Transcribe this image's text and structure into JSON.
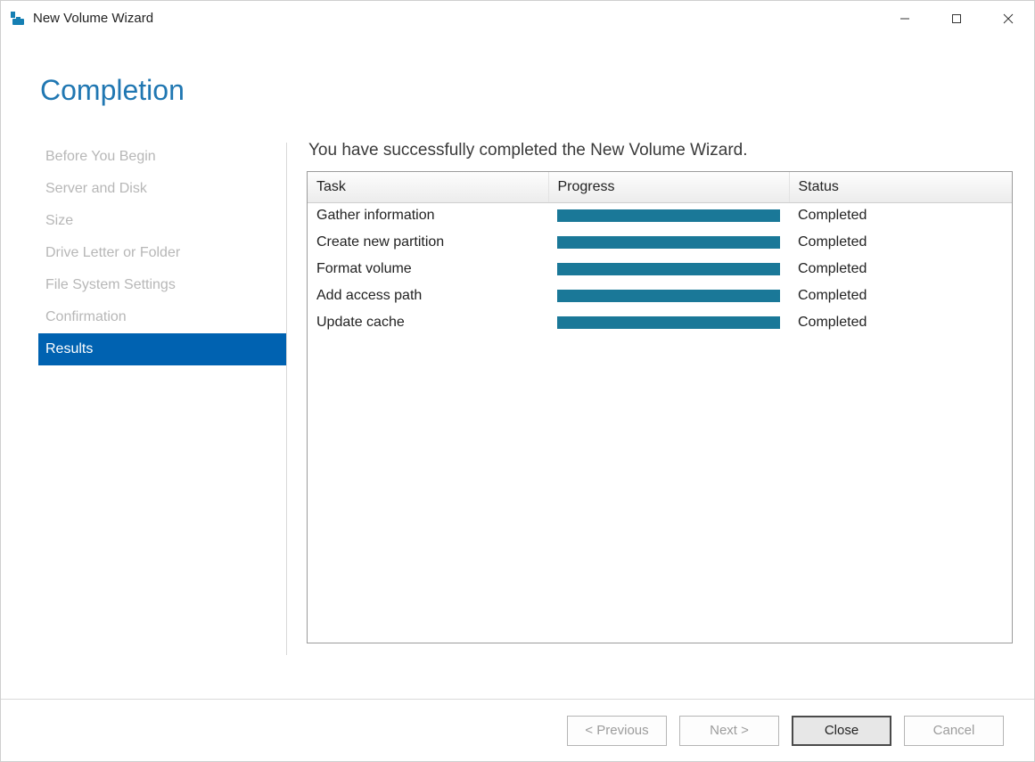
{
  "window": {
    "title": "New Volume Wizard"
  },
  "page": {
    "heading": "Completion",
    "message": "You have successfully completed the New Volume Wizard."
  },
  "sidebar": {
    "steps": [
      {
        "label": "Before You Begin",
        "active": false
      },
      {
        "label": "Server and Disk",
        "active": false
      },
      {
        "label": "Size",
        "active": false
      },
      {
        "label": "Drive Letter or Folder",
        "active": false
      },
      {
        "label": "File System Settings",
        "active": false
      },
      {
        "label": "Confirmation",
        "active": false
      },
      {
        "label": "Results",
        "active": true
      }
    ]
  },
  "table": {
    "headers": {
      "task": "Task",
      "progress": "Progress",
      "status": "Status"
    },
    "rows": [
      {
        "task": "Gather information",
        "status": "Completed",
        "progress": 100
      },
      {
        "task": "Create new partition",
        "status": "Completed",
        "progress": 100
      },
      {
        "task": "Format volume",
        "status": "Completed",
        "progress": 100
      },
      {
        "task": "Add access path",
        "status": "Completed",
        "progress": 100
      },
      {
        "task": "Update cache",
        "status": "Completed",
        "progress": 100
      }
    ]
  },
  "buttons": {
    "previous": "< Previous",
    "next": "Next >",
    "close": "Close",
    "cancel": "Cancel"
  }
}
